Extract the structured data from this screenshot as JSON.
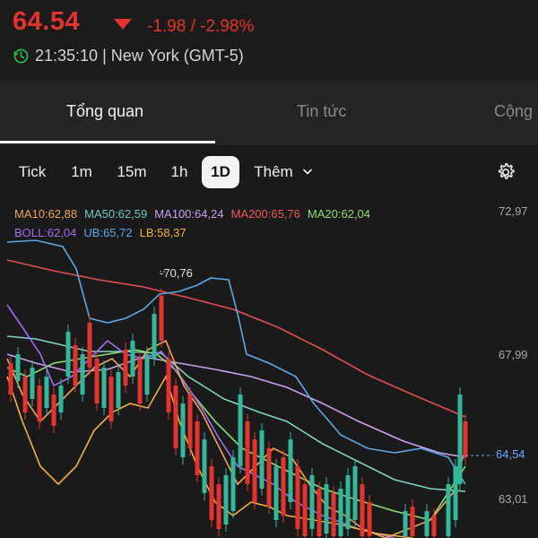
{
  "header": {
    "price": "64.54",
    "change": "-1.98 / -2.98%",
    "time": "21:35:10 | New York (GMT-5)"
  },
  "tabs": [
    {
      "label": "Tổng quan",
      "active": true
    },
    {
      "label": "Tin tức",
      "active": false
    },
    {
      "label": "Cộng",
      "active": false
    }
  ],
  "intervals": [
    {
      "label": "Tick"
    },
    {
      "label": "1m"
    },
    {
      "label": "15m"
    },
    {
      "label": "1h"
    },
    {
      "label": "1D",
      "active": true
    },
    {
      "label": "Thêm"
    }
  ],
  "indicators": {
    "row1": [
      {
        "label": "MA10:62,88",
        "color": "#f0a45a"
      },
      {
        "label": "MA50:62,59",
        "color": "#6fc9b9"
      },
      {
        "label": "MA100:64,24",
        "color": "#c9a0f0"
      },
      {
        "label": "MA200:65,76",
        "color": "#f05a5a"
      },
      {
        "label": "MA20:62,04",
        "color": "#8ddf70"
      }
    ],
    "row2": [
      {
        "label": "BOLL:62,04",
        "color": "#a06cf0"
      },
      {
        "label": "UB:65,72",
        "color": "#5aa8e6"
      },
      {
        "label": "LB:58,37",
        "color": "#f0b040"
      }
    ]
  },
  "chart": {
    "yaxis": [
      "72,97",
      "67,99",
      "63,01"
    ],
    "last_price": "64,54",
    "peak_label": "-70,76"
  },
  "colors": {
    "down": "#e5322d",
    "up": "#2fb89a",
    "accent": "#f2f2f2"
  },
  "icons": {
    "clock": "clock-refresh-icon",
    "arrow": "down-triangle-icon",
    "settings": "gear-icon",
    "more": "chevron-down-icon"
  }
}
